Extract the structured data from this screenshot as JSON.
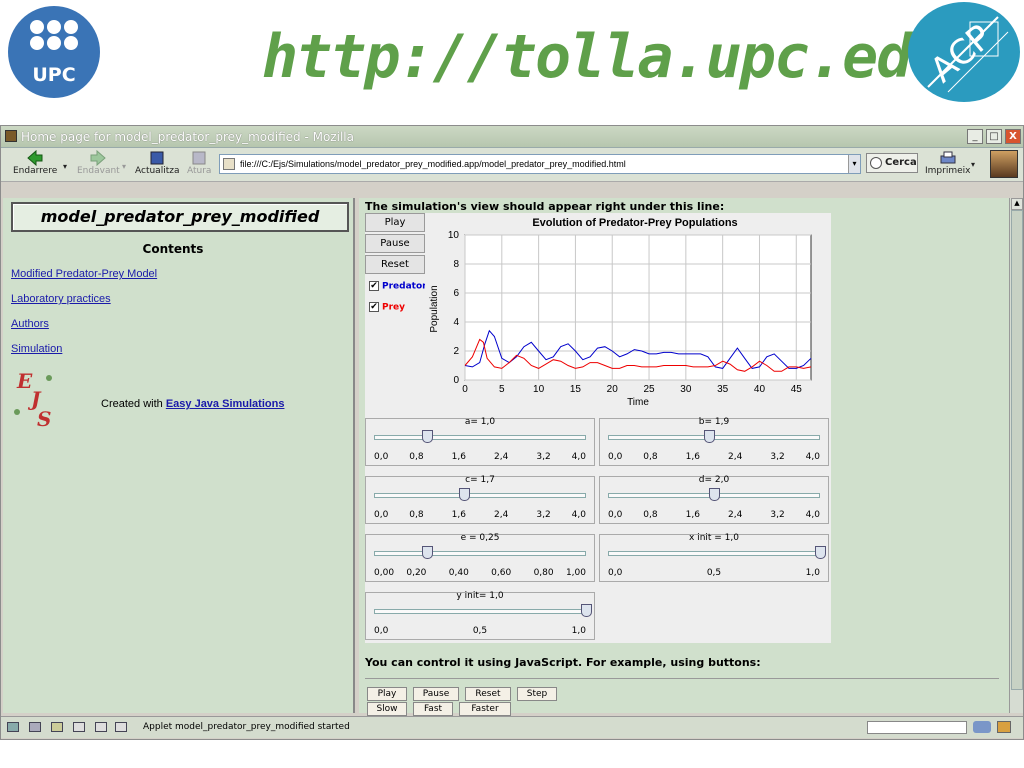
{
  "banner": {
    "upc_logo_text": "UPC",
    "url_text": "http://tolla.upc.edu",
    "acp_logo_text": "ACP"
  },
  "window": {
    "title": "Home page for model_predator_prey_modified - Mozilla",
    "buttons": {
      "minimize": "_",
      "maximize": "□",
      "close": "X"
    }
  },
  "toolbar": {
    "back": "Endarrere",
    "forward": "Endavant",
    "reload": "Actualitza",
    "stop": "Atura",
    "url": "file:///C:/Ejs/Simulations/model_predator_prey_modified.app/model_predator_prey_modified.html",
    "search": "Cerca",
    "print": "Imprimeix"
  },
  "sidebar": {
    "title": "model_predator_prey_modified",
    "contents_heading": "Contents",
    "links": [
      "Modified Predator-Prey Model",
      "Laboratory practices",
      "Authors",
      "Simulation"
    ],
    "ejs_logo": "EJS",
    "created_with": "Created with",
    "ejs_link": "Easy Java Simulations"
  },
  "main": {
    "intro": "The simulation's view should appear right under this line:",
    "js_text": "You can control it using JavaScript. For example, using buttons:",
    "js_buttons_row1": [
      "Play",
      "Pause",
      "Reset",
      "Step"
    ],
    "js_buttons_row2": [
      "Slow",
      "Fast",
      "Faster"
    ]
  },
  "applet": {
    "buttons": [
      "Play",
      "Pause",
      "Reset"
    ],
    "checkboxes": [
      {
        "label": "Predator",
        "checked": true,
        "color": "#0000cc"
      },
      {
        "label": "Prey",
        "checked": true,
        "color": "#ee0000"
      }
    ],
    "sliders": [
      {
        "label": "a= 1,0",
        "value": 1.0,
        "min": 0,
        "max": 4,
        "ticks": [
          "0,0",
          "0,8",
          "1,6",
          "2,4",
          "3,2",
          "4,0"
        ]
      },
      {
        "label": "b= 1,9",
        "value": 1.9,
        "min": 0,
        "max": 4,
        "ticks": [
          "0,0",
          "0,8",
          "1,6",
          "2,4",
          "3,2",
          "4,0"
        ]
      },
      {
        "label": "c= 1,7",
        "value": 1.7,
        "min": 0,
        "max": 4,
        "ticks": [
          "0,0",
          "0,8",
          "1,6",
          "2,4",
          "3,2",
          "4,0"
        ]
      },
      {
        "label": "d= 2,0",
        "value": 2.0,
        "min": 0,
        "max": 4,
        "ticks": [
          "0,0",
          "0,8",
          "1,6",
          "2,4",
          "3,2",
          "4,0"
        ]
      },
      {
        "label": "e = 0,25",
        "value": 0.25,
        "min": 0,
        "max": 1,
        "ticks": [
          "0,00",
          "0,20",
          "0,40",
          "0,60",
          "0,80",
          "1,00"
        ]
      },
      {
        "label": "x init = 1,0",
        "value": 1.0,
        "min": 0,
        "max": 1,
        "ticks": [
          "0,0",
          "0,5",
          "1,0"
        ]
      },
      {
        "label": "y init= 1,0",
        "value": 1.0,
        "min": 0,
        "max": 1,
        "ticks": [
          "0,0",
          "0,5",
          "1,0"
        ]
      }
    ]
  },
  "chart_data": {
    "type": "line",
    "title": "Evolution of Predator-Prey Populations",
    "xlabel": "Time",
    "ylabel": "Population",
    "xlim": [
      0,
      47
    ],
    "ylim": [
      0,
      10
    ],
    "xticks": [
      0,
      5,
      10,
      15,
      20,
      25,
      30,
      35,
      40,
      45
    ],
    "yticks": [
      0,
      2,
      4,
      6,
      8,
      10
    ],
    "grid": true,
    "series": [
      {
        "name": "Predator",
        "color": "#0000cc",
        "x": [
          0,
          1,
          2,
          2.7,
          3.3,
          4,
          5,
          6,
          7,
          8,
          9,
          10,
          11,
          12,
          13,
          14,
          15,
          16,
          17,
          18,
          19,
          20,
          21,
          22,
          23,
          24,
          25,
          26,
          27,
          28,
          29,
          30,
          31,
          32,
          33,
          34,
          35,
          36,
          37,
          38,
          39,
          40,
          41,
          42,
          43,
          44,
          45,
          46,
          47
        ],
        "y": [
          1.0,
          0.9,
          1.2,
          2.5,
          3.4,
          3.0,
          1.5,
          1.2,
          1.6,
          2.3,
          2.6,
          2.0,
          1.4,
          1.6,
          2.3,
          2.5,
          2.0,
          1.4,
          1.6,
          2.2,
          2.3,
          2.0,
          1.6,
          1.8,
          2.1,
          2.0,
          1.8,
          1.8,
          1.9,
          1.9,
          1.8,
          1.8,
          1.8,
          1.8,
          1.6,
          0.9,
          0.8,
          1.5,
          2.2,
          1.5,
          0.8,
          0.9,
          1.6,
          1.8,
          1.3,
          0.8,
          0.8,
          1.0,
          1.5
        ]
      },
      {
        "name": "Prey",
        "color": "#ee0000",
        "x": [
          0,
          1,
          2,
          2.5,
          3,
          4,
          5,
          6,
          7,
          8,
          9,
          10,
          11,
          12,
          13,
          14,
          15,
          16,
          17,
          18,
          19,
          20,
          21,
          22,
          23,
          24,
          25,
          26,
          27,
          28,
          29,
          30,
          31,
          32,
          33,
          34,
          35,
          36,
          37,
          38,
          39,
          40,
          41,
          42,
          43,
          44,
          45,
          46,
          47
        ],
        "y": [
          1.0,
          1.6,
          2.8,
          2.6,
          1.5,
          0.9,
          0.8,
          1.2,
          1.7,
          1.5,
          1.0,
          0.8,
          1.1,
          1.4,
          1.3,
          1.0,
          0.8,
          0.9,
          1.2,
          1.2,
          1.0,
          0.8,
          0.8,
          1.0,
          1.0,
          0.9,
          0.9,
          0.9,
          1.0,
          1.0,
          1.0,
          1.0,
          0.9,
          0.9,
          0.9,
          1.0,
          1.3,
          1.1,
          0.7,
          0.6,
          0.9,
          1.3,
          1.0,
          0.6,
          0.6,
          0.9,
          0.9,
          0.8,
          0.9
        ]
      }
    ]
  },
  "statusbar": {
    "text": "Applet model_predator_prey_modified started"
  }
}
